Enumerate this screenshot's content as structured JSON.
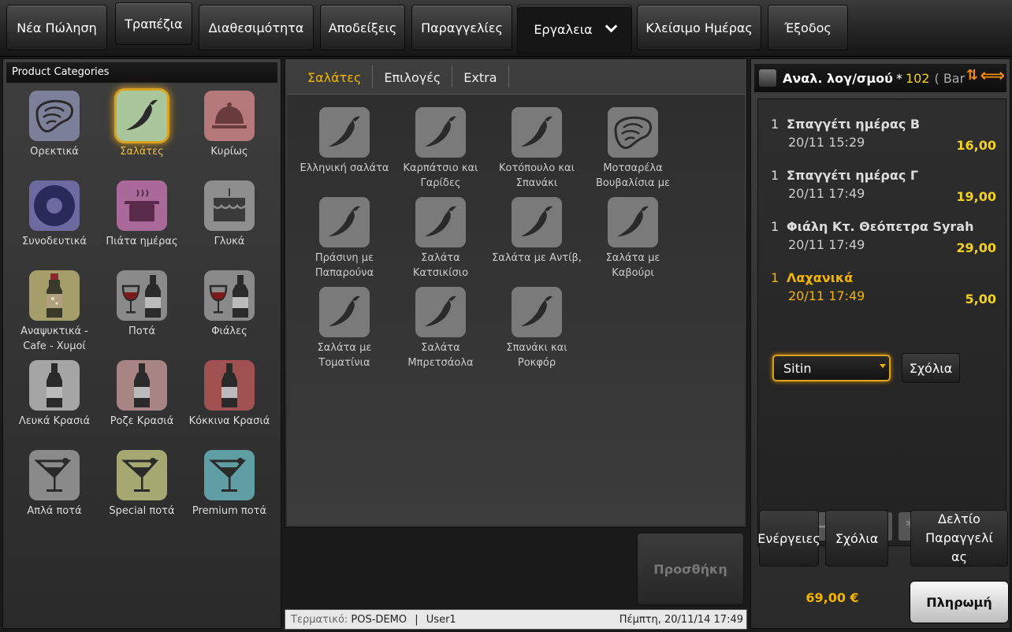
{
  "topnav": {
    "new_sale": "Νέα Πώληση",
    "tables": "Τραπέζια",
    "availability": "Διαθεσιμότητα",
    "receipts": "Αποδείξεις",
    "orders": "Παραγγελίες",
    "tools": "Εργαλεια",
    "end_of_day": "Κλείσιμο Ημέρας",
    "exit": "Έξοδος"
  },
  "categories": {
    "title": "Product Categories",
    "items": [
      {
        "label": "Ορεκτικά",
        "icon": "steak-icon",
        "color": "#7c8199"
      },
      {
        "label": "Σαλάτες",
        "icon": "chili-pepper-icon",
        "color": "#a9c79a"
      },
      {
        "label": "Κυρίως",
        "icon": "cloche-icon",
        "color": "#b5797b"
      },
      {
        "label": "Συνοδευτικά",
        "icon": "donut-icon",
        "color": "#6c6aa0"
      },
      {
        "label": "Πιάτα ημέρας",
        "icon": "cooking-pot-icon",
        "color": "#a96a9a"
      },
      {
        "label": "Γλυκά",
        "icon": "cake-icon",
        "color": "#8e8e8e"
      },
      {
        "label": "Αναψυκτικά - Cafe - Χυμοί",
        "icon": "soda-bottle-icon",
        "color": "#a59d6a"
      },
      {
        "label": "Ποτά",
        "icon": "wine-glass-bottle-icon",
        "color": "#8a8a8a"
      },
      {
        "label": "Φιάλες",
        "icon": "wine-glass-bottle-icon",
        "color": "#8a8a8a"
      },
      {
        "label": "Λευκά Κρασιά",
        "icon": "wine-bottle-icon",
        "color": "#a5a5a5"
      },
      {
        "label": "Ροζε Κρασιά",
        "icon": "wine-bottle-icon",
        "color": "#a88484"
      },
      {
        "label": "Κόκκινα Κρασιά",
        "icon": "wine-bottle-icon",
        "color": "#a05252"
      },
      {
        "label": "Απλά ποτά",
        "icon": "cocktail-icon",
        "color": "#8a8a8a"
      },
      {
        "label": "Special ποτά",
        "icon": "cocktail-icon",
        "color": "#a5a870"
      },
      {
        "label": "Premium ποτά",
        "icon": "cocktail-icon",
        "color": "#5f9ea3"
      }
    ]
  },
  "tabs": [
    "Σαλάτες",
    "Επιλογές",
    "Extra"
  ],
  "products": [
    {
      "label": "Ελληνική σαλάτα",
      "icon": "chili-pepper-icon"
    },
    {
      "label": "Καρπάτσιο και Γαρίδες",
      "icon": "chili-pepper-icon"
    },
    {
      "label": "Κοτόπουλο και Σπανάκι",
      "icon": "chili-pepper-icon"
    },
    {
      "label": "Μοτσαρέλα Βουβαλίσια με",
      "icon": "steak-icon"
    },
    {
      "label": "Πράσινη με Παπαρούνα",
      "icon": "chili-pepper-icon"
    },
    {
      "label": "Σαλάτα Κατσικίσιο",
      "icon": "chili-pepper-icon"
    },
    {
      "label": "Σαλάτα με Αντίβ,",
      "icon": "chili-pepper-icon"
    },
    {
      "label": "Σαλάτα με Καβούρι",
      "icon": "chili-pepper-icon"
    },
    {
      "label": "Σαλάτα με Τοματίνια",
      "icon": "chili-pepper-icon"
    },
    {
      "label": "Σαλάτα Μπρετσάολα",
      "icon": "chili-pepper-icon"
    },
    {
      "label": "Σπανάκι και Ροκφόρ",
      "icon": "chili-pepper-icon"
    }
  ],
  "add_button": "Προσθήκη",
  "status": {
    "terminal_label": "Τερματικό:",
    "terminal": "POS-DEMO",
    "sep": "|",
    "user": "User1",
    "datetime": "Πέμπτη, 20/11/14 17:49"
  },
  "order": {
    "title": "Αναλ. λογ/σμού",
    "star": "*",
    "table": "102",
    "location": "( Bar",
    "lines": [
      {
        "qty": "1",
        "name": "Σπαγγέτι ημέρας Β",
        "time": "20/11 15:29",
        "price": "16,00"
      },
      {
        "qty": "1",
        "name": "Σπαγγέτι ημέρας Γ",
        "time": "20/11 17:49",
        "price": "19,00"
      },
      {
        "qty": "1",
        "name": "Φιάλη   Κτ. Θεόπετρα Syrah",
        "time": "20/11 17:49",
        "price": "29,00"
      },
      {
        "qty": "1",
        "name": "Λαχανικά",
        "time": "20/11 17:49",
        "price": "5,00"
      }
    ],
    "selected_line": 3,
    "modifier_select": "Sitin",
    "comments_inline": "Σχόλια",
    "actions": "Ενέργειες",
    "comments": "Σχόλια",
    "order_ticket": "Δελτίο Παραγγελί ας",
    "total": "69,00 €",
    "pay": "Πληρωμή"
  },
  "toolbar": [
    "+",
    "−",
    "↑",
    "↓",
    "*"
  ],
  "colors": {
    "accent": "#f4b400",
    "price": "#f4d020"
  }
}
